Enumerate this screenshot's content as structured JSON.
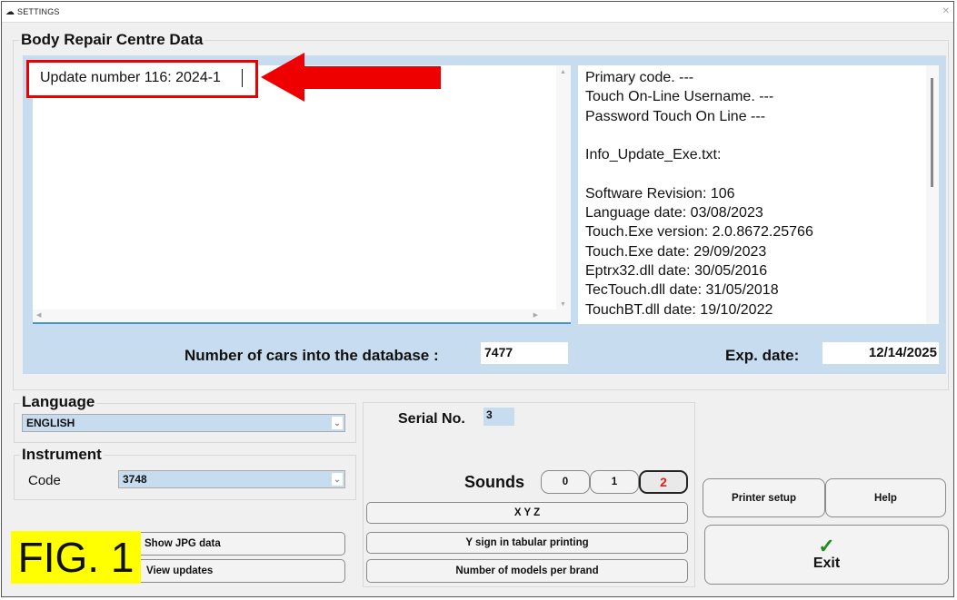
{
  "window": {
    "title": "SETTINGS"
  },
  "main_group": {
    "title": "Body Repair Centre Data"
  },
  "update_box": {
    "text": "Update number  116: 2024-1"
  },
  "info_lines": [
    "Primary code. ---",
    "Touch On-Line Username. ---",
    "Password Touch On Line ---",
    "",
    "Info_Update_Exe.txt:",
    "",
    "Software Revision: 106",
    "Language date: 03/08/2023",
    "Touch.Exe version: 2.0.8672.25766",
    "Touch.Exe date: 29/09/2023",
    "Eptrx32.dll date: 30/05/2016",
    "TecTouch.dll date: 31/05/2018",
    "TouchBT.dll date: 19/10/2022"
  ],
  "cars": {
    "label": "Number of cars into the database :",
    "value": "7477"
  },
  "expiry": {
    "label": "Exp. date:",
    "value": "12/14/2025"
  },
  "language": {
    "title": "Language",
    "value": "ENGLISH"
  },
  "instrument": {
    "title": "Instrument",
    "code_label": "Code",
    "code_value": "3748"
  },
  "serial": {
    "label": "Serial No.",
    "value": "3"
  },
  "sounds": {
    "label": "Sounds",
    "options": [
      "0",
      "1",
      "2"
    ],
    "selected": "2",
    "selected_color": "#e02020"
  },
  "buttons": {
    "xyz": "X Y Z",
    "y_sign": "Y sign in tabular printing",
    "models_per_brand": "Number of models per brand",
    "show_jpg": "Show JPG data",
    "view_updates": "View updates",
    "printer_setup": "Printer setup",
    "help": "Help",
    "exit": "Exit"
  },
  "figure_label": {
    "text": "FIG. 1",
    "background": "#ffff00"
  },
  "annotation": {
    "color": "#ee0000"
  },
  "icons": {
    "exit": "checkmark-icon",
    "title": "app-icon"
  }
}
